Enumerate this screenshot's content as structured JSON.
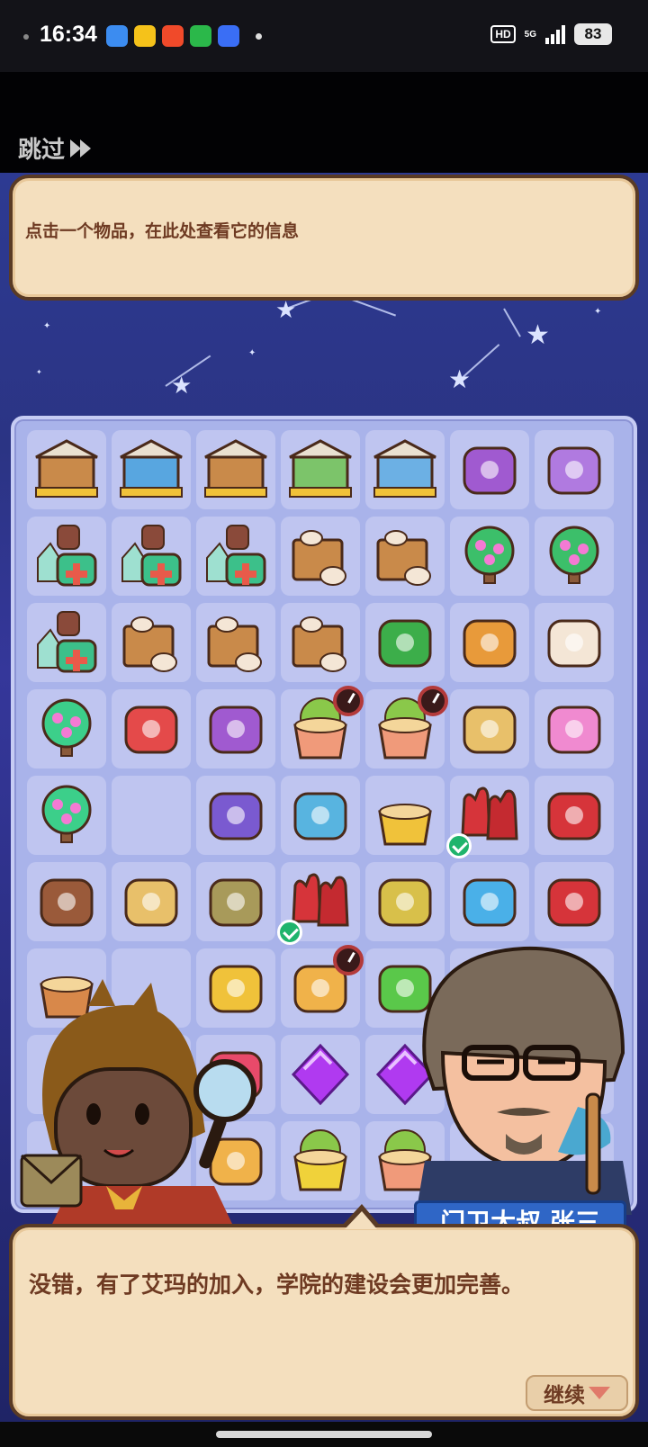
{
  "status_bar": {
    "time": "16:34",
    "app_icons": [
      {
        "name": "notes-app-icon",
        "color": "#3c8cf0"
      },
      {
        "name": "star-app-icon",
        "color": "#f5c21a"
      },
      {
        "name": "video-app-icon",
        "color": "#f04a2a"
      },
      {
        "name": "message-app-icon",
        "color": "#2bb84a"
      },
      {
        "name": "baidu-app-icon",
        "color": "#3a6ef5"
      }
    ],
    "hd_label": "HD",
    "network_label": "5G",
    "battery": "83"
  },
  "skip_label": "跳过",
  "info_text": "点击一个物品，在此处查看它的信息",
  "grid": {
    "columns": 7,
    "rows": 9,
    "cells": [
      {
        "icon": "pet-shop-building-icon",
        "color": "#c98a4a"
      },
      {
        "icon": "pool-building-icon",
        "color": "#58a6e0"
      },
      {
        "icon": "bath-room-building-icon",
        "color": "#c98a4a"
      },
      {
        "icon": "garden-building-icon",
        "color": "#7cc46a"
      },
      {
        "icon": "paw-room-building-icon",
        "color": "#6cb0e4"
      },
      {
        "icon": "moth-icon",
        "color": "#a05ad0"
      },
      {
        "icon": "helicopter-icon",
        "color": "#b07ae0"
      },
      {
        "icon": "medicine-kit-icon",
        "color": "#3cc08a"
      },
      {
        "icon": "medicine-kit-icon",
        "color": "#3cc08a"
      },
      {
        "icon": "medicine-kit-icon",
        "color": "#3cc08a"
      },
      {
        "icon": "crate-icon",
        "color": "#c98a4a"
      },
      {
        "icon": "crate-icon",
        "color": "#c98a4a"
      },
      {
        "icon": "flower-tree-icon",
        "color": "#f47ad4"
      },
      {
        "icon": "flower-tree-icon",
        "color": "#f47ad4"
      },
      {
        "icon": "medicine-kit-icon",
        "color": "#3cc08a"
      },
      {
        "icon": "crate-icon",
        "color": "#c98a4a"
      },
      {
        "icon": "crate-icon",
        "color": "#c98a4a"
      },
      {
        "icon": "crate-icon",
        "color": "#c98a4a"
      },
      {
        "icon": "broom-icon",
        "color": "#3cae4a"
      },
      {
        "icon": "vase-icon",
        "color": "#e89a3a"
      },
      {
        "icon": "rabbit-statue-icon",
        "color": "#f4e6d6"
      },
      {
        "icon": "green-tree-icon",
        "color": "#3ccf8a"
      },
      {
        "icon": "trash-bin-icon",
        "color": "#e44a4a"
      },
      {
        "icon": "airplane-icon",
        "color": "#a05ad0"
      },
      {
        "icon": "flower-pot-icon",
        "color": "#9ed84a",
        "timer": true
      },
      {
        "icon": "flower-pot-icon",
        "color": "#9ed84a",
        "timer": true
      },
      {
        "icon": "scarecrow-icon",
        "color": "#e8c06a"
      },
      {
        "icon": "flower-basket-icon",
        "color": "#f08ad0"
      },
      {
        "icon": "green-tree-icon",
        "color": "#3ccf8a"
      },
      {
        "icon": "empty-slot-icon",
        "color": ""
      },
      {
        "icon": "motorbike-icon",
        "color": "#7a5ad0"
      },
      {
        "icon": "jet-ski-icon",
        "color": "#58b4e0"
      },
      {
        "icon": "bucket-icon",
        "color": "#f0c23a"
      },
      {
        "icon": "red-gloves-icon",
        "color": "#d6343a",
        "check": true
      },
      {
        "icon": "toolbox-icon",
        "color": "#d6343a"
      },
      {
        "icon": "envelope-icon",
        "color": "#9a5a3a"
      },
      {
        "icon": "doll-icon",
        "color": "#e8c06a"
      },
      {
        "icon": "seed-bag-stack-icon",
        "color": "#a89a5a"
      },
      {
        "icon": "red-gloves-icon",
        "color": "#d6343a",
        "check": true
      },
      {
        "icon": "gold-sack-icon",
        "color": "#d8c04a"
      },
      {
        "icon": "hourglass-icon",
        "color": "#4ab0e8"
      },
      {
        "icon": "toolbox-icon",
        "color": "#d6343a"
      },
      {
        "icon": "clay-pot-icon",
        "color": "#d8884a"
      },
      {
        "icon": "empty-slot-icon",
        "color": ""
      },
      {
        "icon": "cocktail-icon",
        "color": "#f0c23a"
      },
      {
        "icon": "gift-box-icon",
        "color": "#f0b24a",
        "timer": true
      },
      {
        "icon": "glowing-plant-icon",
        "color": "#5ac84a"
      },
      {
        "icon": "hidden-slot-icon",
        "color": ""
      },
      {
        "icon": "hidden-slot-icon",
        "color": ""
      },
      {
        "icon": "hidden-slot-icon",
        "color": ""
      },
      {
        "icon": "hidden-slot-icon",
        "color": ""
      },
      {
        "icon": "fireworks-icon",
        "color": "#e84a6a"
      },
      {
        "icon": "purple-gem-icon",
        "color": "#b03af0"
      },
      {
        "icon": "purple-gem-icon",
        "color": "#b03af0"
      },
      {
        "icon": "hidden-slot-icon",
        "color": ""
      },
      {
        "icon": "hidden-slot-icon",
        "color": ""
      },
      {
        "icon": "hidden-slot-icon",
        "color": ""
      },
      {
        "icon": "hidden-slot-icon",
        "color": ""
      },
      {
        "icon": "cake-stand-icon",
        "color": "#f0b24a"
      },
      {
        "icon": "planter-box-icon",
        "color": "#f0d23a"
      },
      {
        "icon": "potted-plant-icon",
        "color": "#6cc84a"
      },
      {
        "icon": "hidden-slot-icon",
        "color": ""
      },
      {
        "icon": "hidden-slot-icon",
        "color": ""
      }
    ]
  },
  "characters": {
    "left": {
      "icon": "detective-girl-icon"
    },
    "right": {
      "icon": "gatekeeper-uncle-icon"
    }
  },
  "speaker_name": "门卫大叔 张三",
  "dialog_text": "没错，有了艾玛的加入，学院的建设会更加完善。",
  "continue_label": "继续"
}
